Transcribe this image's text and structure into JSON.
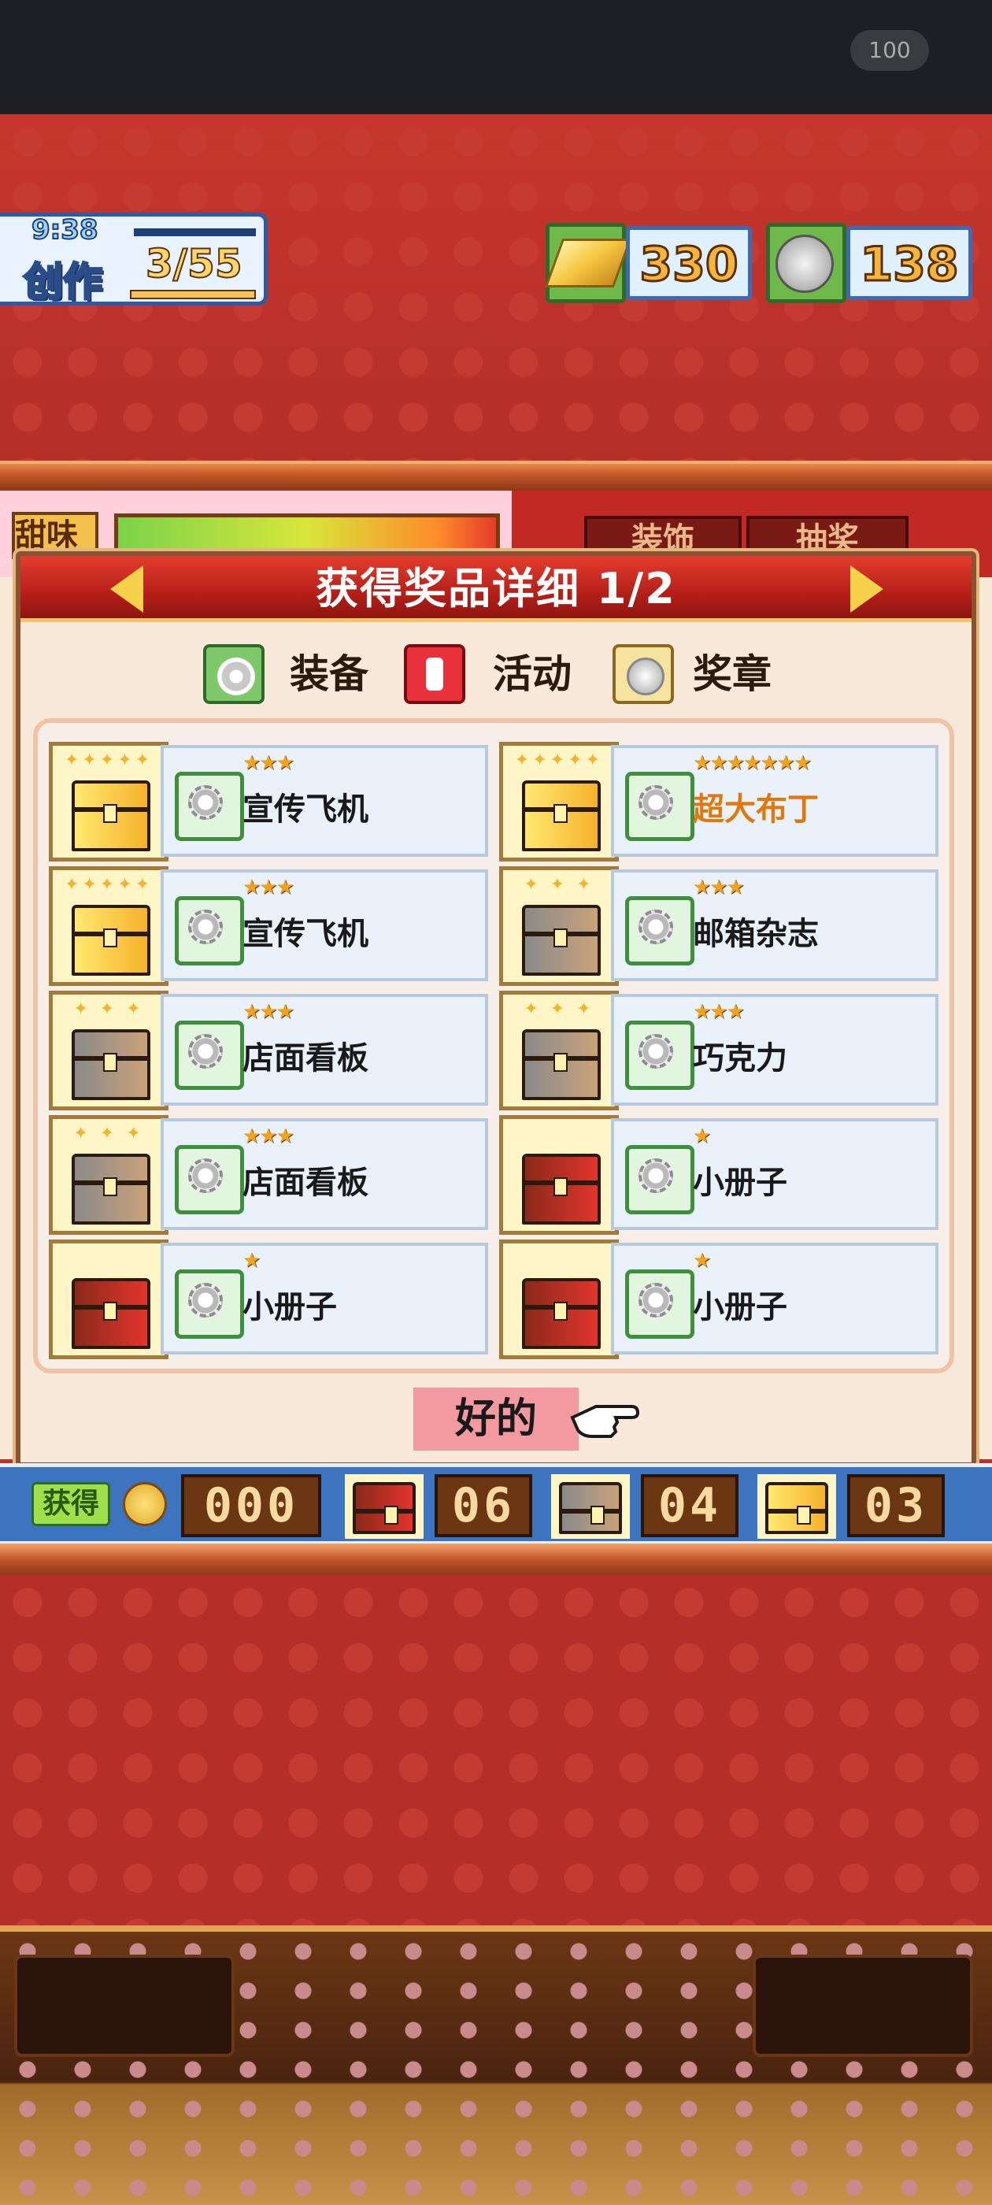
{
  "status": {
    "battery": "100"
  },
  "header": {
    "create_label": "创作",
    "create_time": "9:38",
    "create_count": "3/55",
    "gold": "330",
    "medals": "138"
  },
  "background": {
    "left_label": "甜味",
    "tabs": [
      "装饰",
      "抽奖"
    ]
  },
  "dialog": {
    "title": "获得奖品详细 1/2",
    "legend": [
      {
        "icon": "gear-icon",
        "label": "装备"
      },
      {
        "icon": "exclamation-icon",
        "label": "活动"
      },
      {
        "icon": "medal-icon",
        "label": "奖章"
      }
    ],
    "items": [
      {
        "chest": "gold",
        "stars": "★★★",
        "name": "宣传飞机",
        "rare": false
      },
      {
        "chest": "gold",
        "stars": "★★★★★★★",
        "name": "超大布丁",
        "rare": true
      },
      {
        "chest": "gold",
        "stars": "★★★",
        "name": "宣传飞机",
        "rare": false
      },
      {
        "chest": "silver",
        "stars": "★★★",
        "name": "邮箱杂志",
        "rare": false
      },
      {
        "chest": "silver",
        "stars": "★★★",
        "name": "店面看板",
        "rare": false
      },
      {
        "chest": "silver",
        "stars": "★★★",
        "name": "巧克力",
        "rare": false
      },
      {
        "chest": "silver",
        "stars": "★★★",
        "name": "店面看板",
        "rare": false
      },
      {
        "chest": "red",
        "stars": "★",
        "name": "小册子",
        "rare": false
      },
      {
        "chest": "red",
        "stars": "★",
        "name": "小册子",
        "rare": false
      },
      {
        "chest": "red",
        "stars": "★",
        "name": "小册子",
        "rare": false
      }
    ],
    "ok_label": "好的"
  },
  "counters": {
    "obtained_label": "获得",
    "coins": "000",
    "red_chests": "06",
    "silver_chests": "04",
    "gold_chests": "03"
  }
}
